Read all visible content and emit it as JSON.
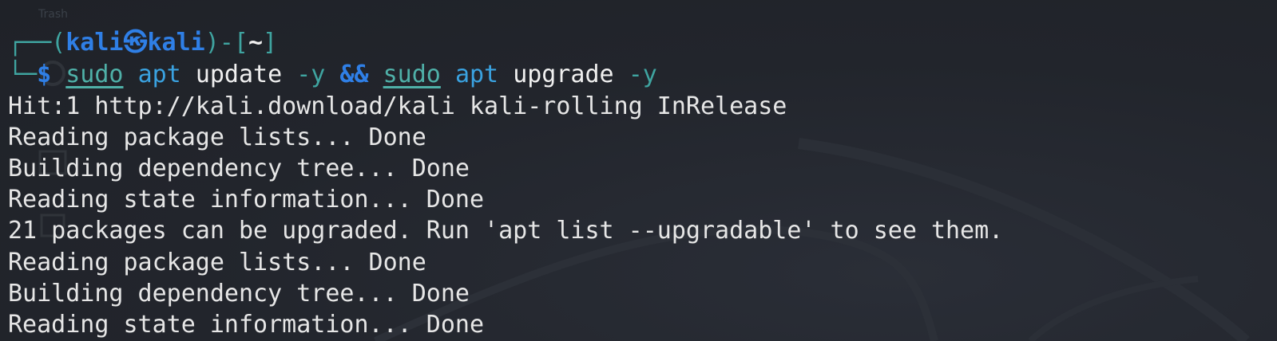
{
  "desktop": {
    "trash_label": "Trash"
  },
  "prompt": {
    "open_paren": "┌──(",
    "user": "kali",
    "separator_icon": "kali-skull-icon",
    "separator_glyph": "㉿",
    "host": "kali",
    "mid": ")-[",
    "dir": "~",
    "close": "]",
    "corner": "└─",
    "dollar": "$"
  },
  "command": {
    "sudo1": "sudo",
    "apt1": "apt",
    "arg1": "update",
    "flag1": "-y",
    "op": "&&",
    "sudo2": "sudo",
    "apt2": "apt",
    "arg2": "upgrade",
    "flag2": "-y"
  },
  "output": [
    "Hit:1 http://kali.download/kali kali-rolling InRelease",
    "Reading package lists... Done",
    "Building dependency tree... Done",
    "Reading state information... Done",
    "21 packages can be upgraded. Run 'apt list --upgradable' to see them.",
    "Reading package lists... Done",
    "Building dependency tree... Done",
    "Reading state information... Done"
  ],
  "colors": {
    "background": "#23262e",
    "prompt_blue": "#2f7fe6",
    "prompt_teal": "#3fa4a0",
    "text": "#e8e8e8"
  }
}
